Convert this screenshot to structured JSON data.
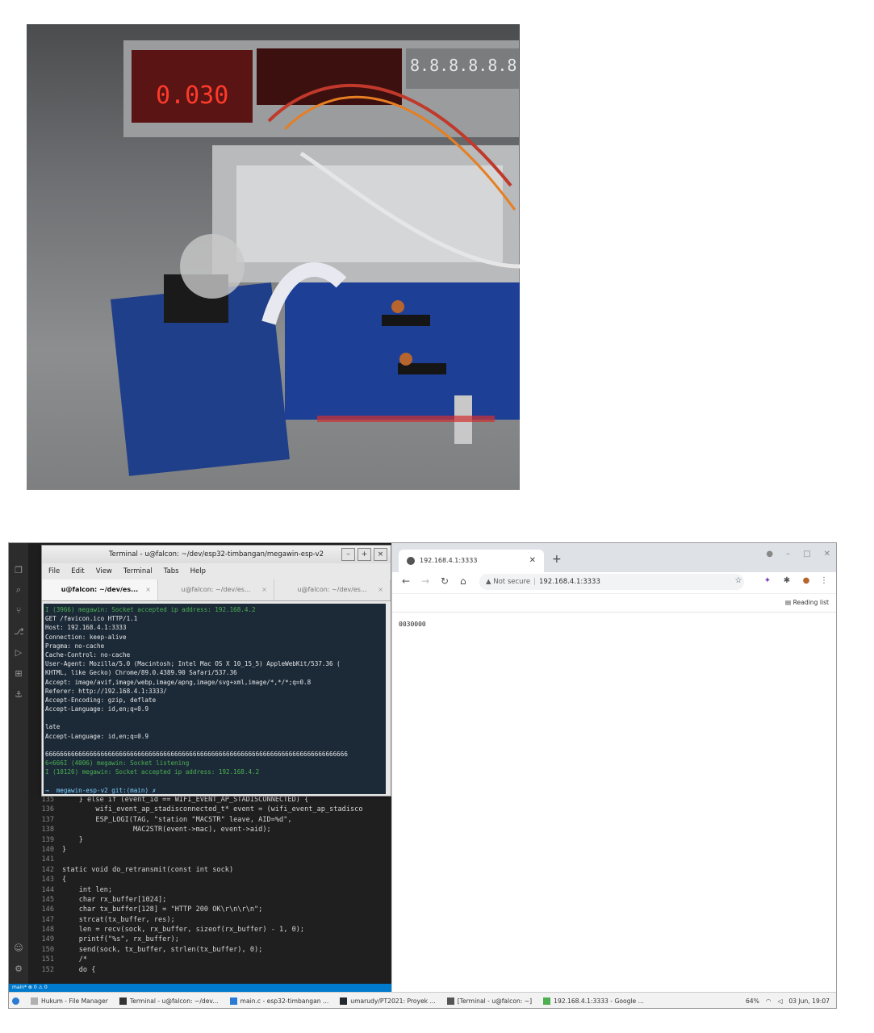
{
  "photo": {
    "display_reading": "0.030",
    "secondary_display": "8.8.8.8.8.8"
  },
  "terminal": {
    "title": "Terminal - u@falcon: ~/dev/esp32-timbangan/megawin-esp-v2",
    "menu": [
      "File",
      "Edit",
      "View",
      "Terminal",
      "Tabs",
      "Help"
    ],
    "tabs": [
      {
        "label": "u@falcon: ~/dev/es...",
        "active": true
      },
      {
        "label": "u@falcon: ~/dev/es...",
        "active": false
      },
      {
        "label": "u@falcon: ~/dev/es...",
        "active": false
      }
    ],
    "lines": [
      {
        "text": "I (3966) megawin: Socket accepted ip address: 192.168.4.2",
        "style": "green"
      },
      {
        "text": "GET /favicon.ico HTTP/1.1",
        "style": ""
      },
      {
        "text": "Host: 192.168.4.1:3333",
        "style": ""
      },
      {
        "text": "Connection: keep-alive",
        "style": ""
      },
      {
        "text": "Pragma: no-cache",
        "style": ""
      },
      {
        "text": "Cache-Control: no-cache",
        "style": ""
      },
      {
        "text": "User-Agent: Mozilla/5.0 (Macintosh; Intel Mac OS X 10_15_5) AppleWebKit/537.36 (",
        "style": ""
      },
      {
        "text": "KHTML, like Gecko) Chrome/89.0.4389.90 Safari/537.36",
        "style": ""
      },
      {
        "text": "Accept: image/avif,image/webp,image/apng,image/svg+xml,image/*,*/*;q=0.8",
        "style": ""
      },
      {
        "text": "Referer: http://192.168.4.1:3333/",
        "style": ""
      },
      {
        "text": "Accept-Encoding: gzip, deflate",
        "style": ""
      },
      {
        "text": "Accept-Language: id,en;q=0.9",
        "style": ""
      },
      {
        "text": "",
        "style": "blank"
      },
      {
        "text": "late",
        "style": ""
      },
      {
        "text": "Accept-Language: id,en;q=0.9",
        "style": ""
      },
      {
        "text": "",
        "style": "blank"
      },
      {
        "text": "6666666666666666666666666666666666666666666666666666666666666666666666666666666666",
        "style": ""
      },
      {
        "text": "6<666I (4006) megawin: Socket listening",
        "style": "green"
      },
      {
        "text": "I (10126) megawin: Socket accepted ip address: 192.168.4.2",
        "style": "green"
      },
      {
        "text": "",
        "style": "blank"
      }
    ],
    "prompt": "→  megawin-esp-v2 git:(main) ✗ "
  },
  "editor": {
    "lines": [
      {
        "n": "135",
        "code": "    } else if (event_id == WIFI_EVENT_AP_STADISCONNECTED) {"
      },
      {
        "n": "136",
        "code": "        wifi_event_ap_stadisconnected_t* event = (wifi_event_ap_stadisco"
      },
      {
        "n": "137",
        "code": "        ESP_LOGI(TAG, \"station \"MACSTR\" leave, AID=%d\","
      },
      {
        "n": "138",
        "code": "                 MAC2STR(event->mac), event->aid);"
      },
      {
        "n": "139",
        "code": "    }"
      },
      {
        "n": "140",
        "code": "}"
      },
      {
        "n": "141",
        "code": ""
      },
      {
        "n": "142",
        "code": "static void do_retransmit(const int sock)"
      },
      {
        "n": "143",
        "code": "{"
      },
      {
        "n": "144",
        "code": "    int len;"
      },
      {
        "n": "145",
        "code": "    char rx_buffer[1024];"
      },
      {
        "n": "146",
        "code": "    char tx_buffer[128] = \"HTTP 200 OK\\r\\n\\r\\n\";"
      },
      {
        "n": "147",
        "code": "    strcat(tx_buffer, res);"
      },
      {
        "n": "148",
        "code": "    len = recv(sock, rx_buffer, sizeof(rx_buffer) - 1, 0);"
      },
      {
        "n": "149",
        "code": "    printf(\"%s\", rx_buffer);"
      },
      {
        "n": "150",
        "code": "    send(sock, tx_buffer, strlen(tx_buffer), 0);"
      },
      {
        "n": "151",
        "code": "    /*"
      },
      {
        "n": "152",
        "code": "    do {"
      }
    ],
    "status": "main*  ⊗ 0 ⚠ 0"
  },
  "browser": {
    "tab_title": "192.168.4.1:3333",
    "security": "Not secure",
    "url": "192.168.4.1:3333",
    "reading_list": "Reading list",
    "content": "0030000"
  },
  "taskbar": {
    "items": [
      "Hukum - File Manager",
      "Terminal - u@falcon: ~/dev...",
      "main.c - esp32-timbangan ...",
      "umarudy/PT2021: Proyek ...",
      "[Terminal - u@falcon: ~]",
      "192.168.4.1:3333 - Google ..."
    ],
    "battery": "64%",
    "clock": "03 Jun, 19:07"
  }
}
